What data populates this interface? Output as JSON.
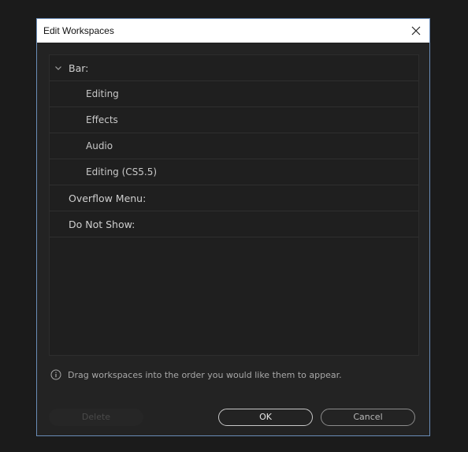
{
  "dialog": {
    "title": "Edit Workspaces",
    "close_icon": "close-icon"
  },
  "workspaces": {
    "bar_label": "Bar:",
    "bar_items": [
      "Editing",
      "Effects",
      "Audio",
      "Editing (CS5.5)"
    ],
    "overflow_label": "Overflow Menu:",
    "do_not_show_label": "Do Not Show:"
  },
  "hint": {
    "icon": "info-icon",
    "text": "Drag workspaces into the order you would like them to appear."
  },
  "buttons": {
    "delete": "Delete",
    "ok": "OK",
    "cancel": "Cancel"
  },
  "colors": {
    "background": "#1b1b1b",
    "dialog_bg": "#232323",
    "dialog_border": "#6a8db8",
    "titlebar": "#ffffff"
  }
}
